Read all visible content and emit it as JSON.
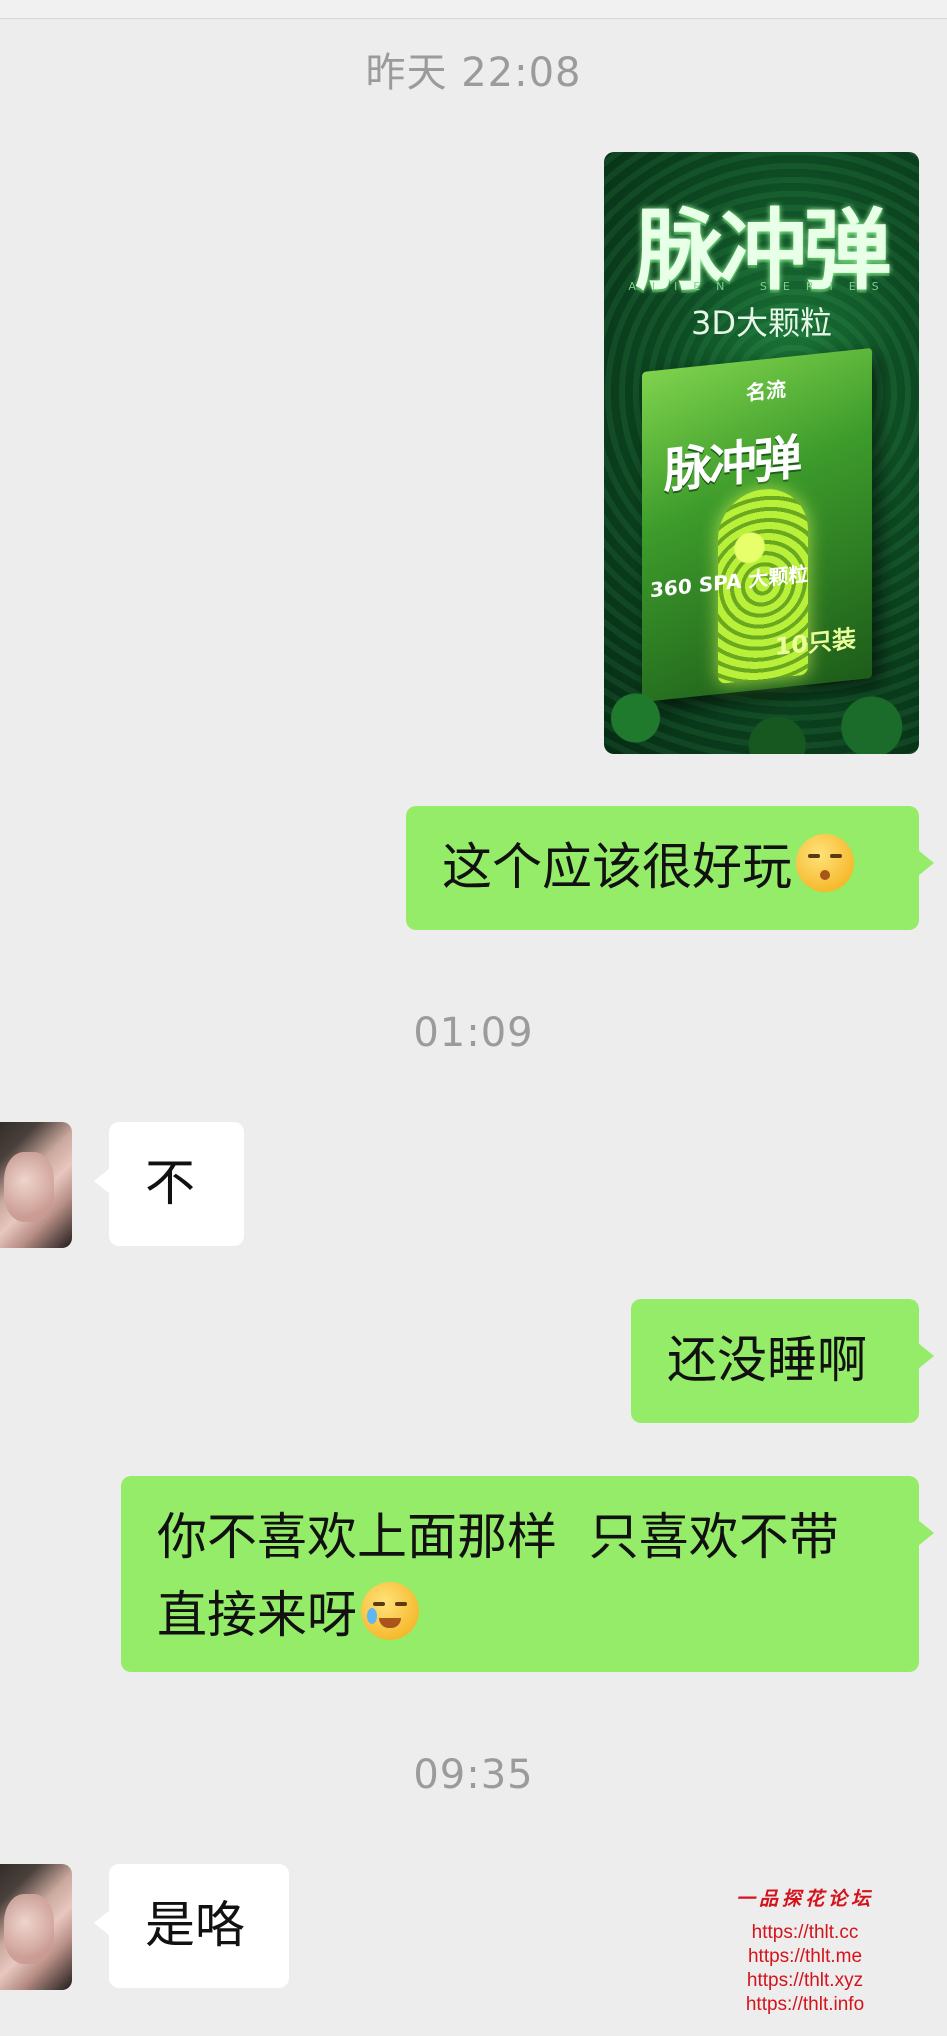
{
  "chat": {
    "timestamps": [
      "昨天 22:08",
      "01:09",
      "09:35"
    ],
    "image": {
      "title": "脉冲弹",
      "series_text": "ALIEN SERIES",
      "subtitle": "3D大颗粒",
      "box_brand": "名流",
      "box_title": "脉冲弹",
      "box_spa": "360 SPA 大颗粒",
      "box_count": "10只装"
    },
    "messages": [
      {
        "from": "me",
        "text": "这个应该很好玩",
        "emoji": "shushing-face-icon"
      },
      {
        "from": "them",
        "text": "不"
      },
      {
        "from": "me",
        "text": "还没睡啊"
      },
      {
        "from": "me",
        "text_line1": "你不喜欢上面那样  只喜欢不带",
        "text_line2": "直接来呀",
        "emoji": "crying-laughing-face-icon"
      },
      {
        "from": "them",
        "text": "是咯"
      }
    ]
  },
  "watermark": {
    "title": "一品探花论坛",
    "links": [
      "https://thlt.cc",
      "https://thlt.me",
      "https://thlt.xyz",
      "https://thlt.info"
    ]
  },
  "colors": {
    "background": "#ededed",
    "outgoing_bubble": "#95ec69",
    "incoming_bubble": "#ffffff",
    "timestamp": "#9b9b9b",
    "watermark": "#d4141c"
  }
}
